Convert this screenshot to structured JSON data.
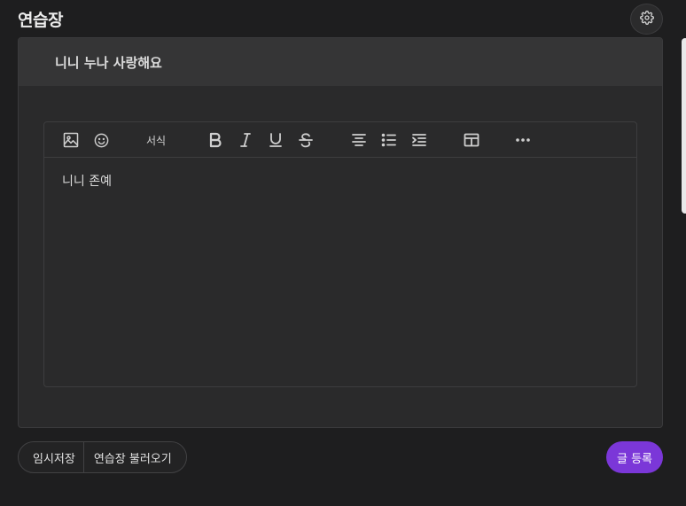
{
  "page": {
    "title": "연습장"
  },
  "editor": {
    "title": "니니 누나 사랑해요",
    "body": "니니 존예",
    "toolbar": {
      "format_label": "서식",
      "icons": [
        "image-icon",
        "emoji-icon",
        "bold-icon",
        "italic-icon",
        "underline-icon",
        "strikethrough-icon",
        "align-center-icon",
        "bullet-list-icon",
        "indent-icon",
        "table-icon",
        "more-icon"
      ]
    }
  },
  "actions": {
    "temp_save": "임시저장",
    "load_drafts": "연습장 불러오기",
    "submit": "글 등록"
  },
  "colors": {
    "background": "#1e1e1f",
    "card": "#2a2a2b",
    "title_bar": "#353536",
    "accent": "#7b37d8"
  }
}
